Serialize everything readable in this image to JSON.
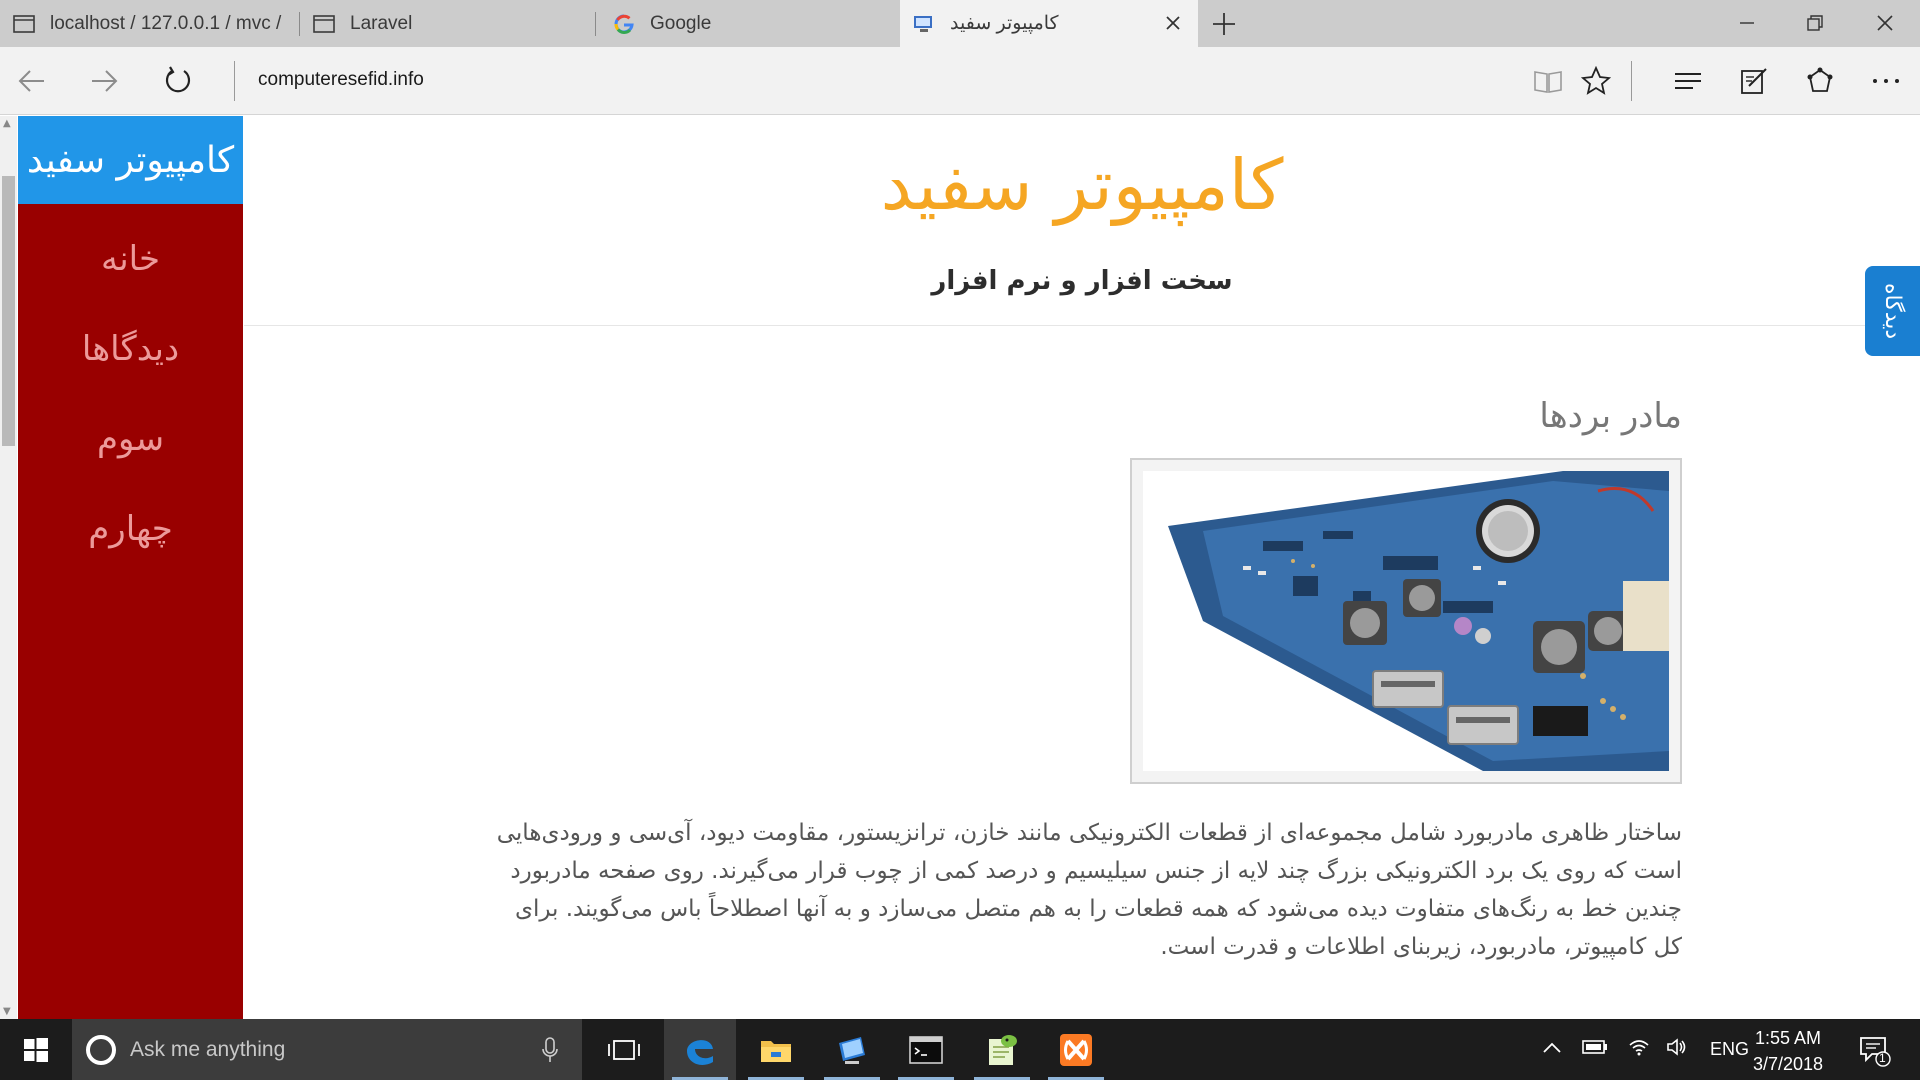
{
  "browser": {
    "tabs": [
      {
        "title": "localhost / 127.0.0.1 / mvc /",
        "icon": "page-icon",
        "active": false
      },
      {
        "title": "Laravel",
        "icon": "page-icon",
        "active": false
      },
      {
        "title": "Google",
        "icon": "google-icon",
        "active": false
      },
      {
        "title": "کامپیوتر سفید",
        "icon": "site-favicon",
        "active": true
      }
    ],
    "url": "computeresefid.info",
    "toolbar_icons": [
      "reading-view-icon",
      "favorite-star-icon",
      "hub-icon",
      "web-note-icon",
      "share-icon",
      "more-icon"
    ]
  },
  "site": {
    "brand": "کامپیوتر سفید",
    "menu": [
      "خانه",
      "دیدگاها",
      "سوم",
      "چهارم"
    ],
    "title": "کامپیوتر سفید",
    "subtitle": "سخت افزار و نرم افزار",
    "feedback_tab": "دیدگاه",
    "colors": {
      "sidebar": "#990000",
      "brand_bg": "#2196e8",
      "title": "#f5a623",
      "feedback": "#1a7fd1"
    }
  },
  "article": {
    "title": "مادر بردها",
    "image_alt": "motherboard-photo",
    "body": "ساختار ظاهری مادربورد شامل مجموعه‌ای از قطعات الکترونیکی مانند خازن، ترانزیستور، مقاومت دیود، آی‌سی و ورودی‌هایی است که روی یک برد الکترونیکی بزرگ چند لایه از جنس سیلیسیم و درصد کمی از چوب قرار می‌گیرند. روی صفحه مادربورد چندین خط به رنگ‌های متفاوت دیده می‌شود که همه قطعات را به هم متصل می‌سازد و به آنها اصطلاحاً باس می‌گویند. برای کل کامپیوتر، مادربورد، زیربنای اطلاعات و قدرت است."
  },
  "taskbar": {
    "search_placeholder": "Ask me anything",
    "apps": [
      "task-view-icon",
      "edge-icon",
      "file-explorer-icon",
      "remote-desktop-icon",
      "command-prompt-icon",
      "notepad-plus-icon",
      "xampp-icon"
    ],
    "language": "ENG",
    "time": "1:55 AM",
    "date": "3/7/2018",
    "notification_count": "1"
  }
}
